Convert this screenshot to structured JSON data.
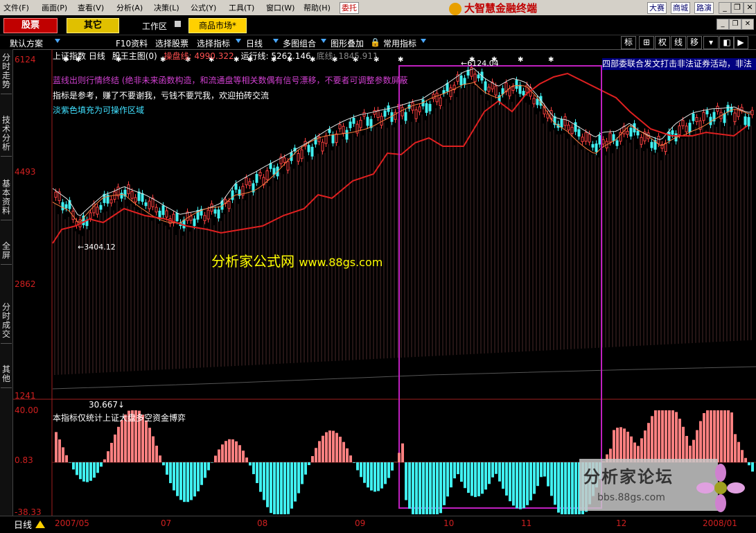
{
  "menu": {
    "items": [
      "文件(F)",
      "画面(P)",
      "查看(V)",
      "分析(A)",
      "决策(L)",
      "公式(Y)",
      "工具(T)",
      "窗口(W)",
      "帮助(H)"
    ],
    "entrust": "委托",
    "brand": "大智慧金融终端",
    "right_buttons": [
      "大赛",
      "商城",
      "路演"
    ]
  },
  "toolbar": {
    "stock_btn": "股票",
    "other_btn": "其它",
    "workspace": "工作区",
    "market_btn": "商品市场*"
  },
  "toolbar2": {
    "items": [
      "默认方案",
      "F10资料",
      "选择股票",
      "选择指标",
      "日线",
      "多图组合",
      "图形叠加",
      "常用指标"
    ],
    "right": [
      "标",
      "权",
      "线",
      "移"
    ]
  },
  "sidebar": {
    "tabs": [
      "分时走势",
      "技术分析",
      "基本资料",
      "全屏",
      "分时成交",
      "其他"
    ]
  },
  "chart": {
    "header": {
      "name": "上证指数",
      "period": "日线",
      "indicator": "股王主图(0)",
      "line1_label": "操盘线:",
      "line1_value": "4990.322",
      "line2_label": "运行线:",
      "line2_value": "5262.146",
      "line3_label": "底线:",
      "line3_value": "1845.911"
    },
    "notes": [
      "蓝线出则行情终结 (绝非未来函数构造，和流通盘等相关数偶有信号漂移，不要者可调整参数屏蔽",
      "指标是参考，赚了不要谢我，亏钱不要咒我，欢迎拍砖交流",
      "淡紫色填充为可操作区域"
    ],
    "peak_label": "←6124.04",
    "low_label": "←3404.12",
    "y_labels": [
      "6124",
      "4493",
      "2862",
      "1241"
    ],
    "sub": {
      "value": "30.667↓",
      "note": "本指标仅统计上证大盘多空资金博弈",
      "y_labels": [
        "40.00",
        "0.83",
        "-38.33"
      ]
    },
    "news": "四部委联合发文打击非法证券活动，非法",
    "watermark_cn": "分析家公式网",
    "watermark_url": "www.88gs.com",
    "forum_title": "分析家论坛",
    "forum_url": "bbs.88gs.com"
  },
  "bottom": {
    "period": "日线",
    "dates": [
      "2007/05",
      "07",
      "08",
      "09",
      "10",
      "11",
      "12",
      "2008/01"
    ]
  },
  "colors": {
    "up": "#ff4040",
    "down": "#40f0f0",
    "mid": "#ff8080",
    "weak": "#a03030",
    "box": "#c020c0"
  }
}
